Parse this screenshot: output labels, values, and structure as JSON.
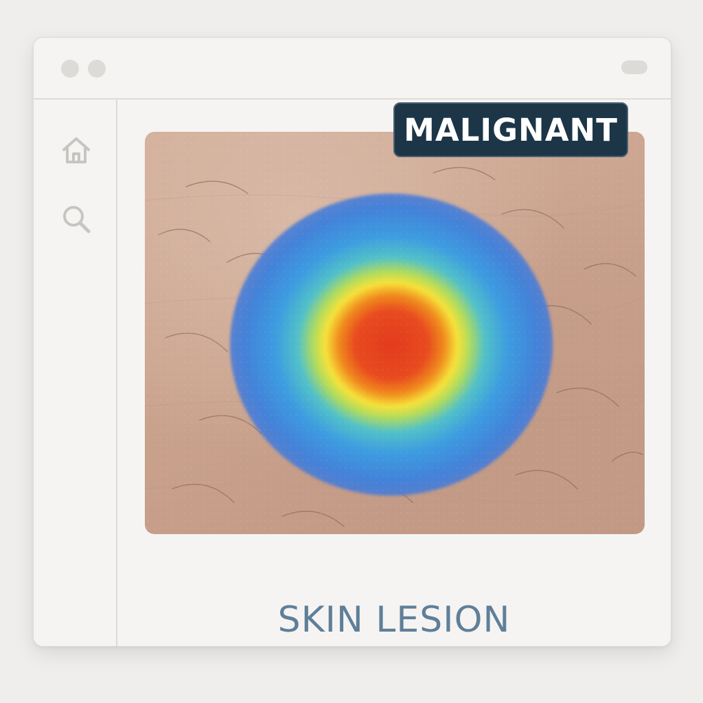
{
  "window": {
    "titlebar_controls": [
      "window-dot",
      "window-dot"
    ],
    "titlebar_right_control": "window-pill"
  },
  "sidebar": {
    "items": [
      {
        "icon": "home-icon"
      },
      {
        "icon": "search-icon"
      }
    ]
  },
  "main": {
    "image": {
      "subject": "skin-heatmap-image",
      "heatmap_colors": [
        "#e23a1e",
        "#f6e23a",
        "#52c1c8",
        "#3d9ce0"
      ]
    },
    "badge_label": "MALIGNANT",
    "caption": "SKIN LESION"
  },
  "colors": {
    "badge_background": "#1c3547",
    "caption_text": "#5f7f99",
    "window_background": "#f5f4f2"
  }
}
